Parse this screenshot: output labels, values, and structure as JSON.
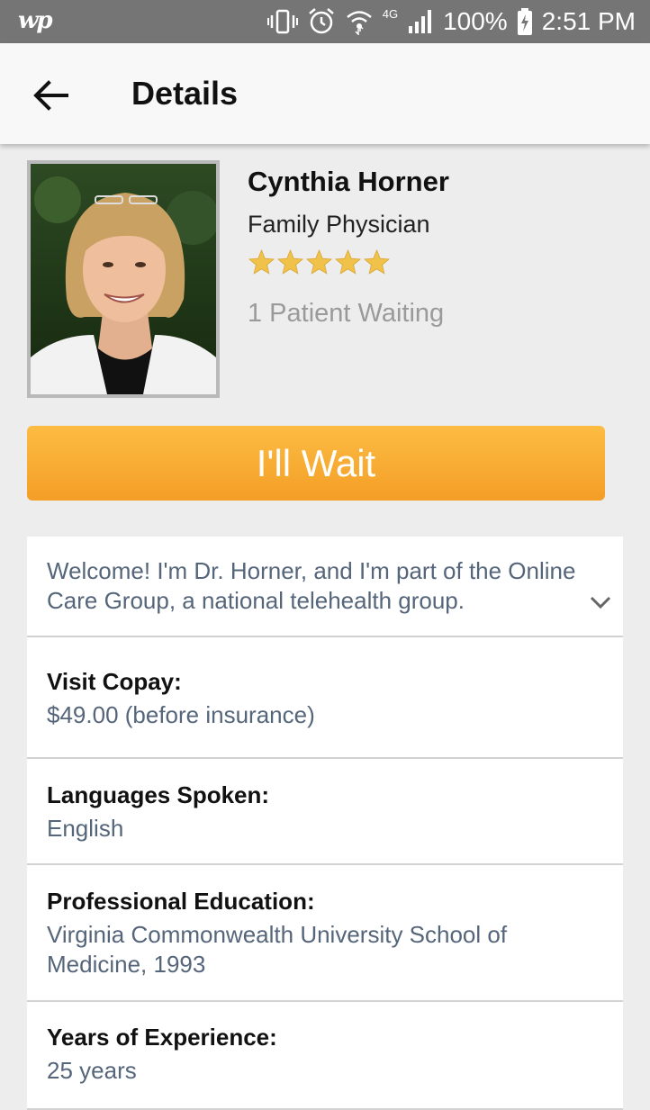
{
  "status_bar": {
    "app_badge": "wp",
    "battery": "100%",
    "time": "2:51 PM",
    "network": "4G"
  },
  "appbar": {
    "title": "Details",
    "back_icon": "arrow-back-icon"
  },
  "doctor": {
    "name": "Cynthia Horner",
    "specialty": "Family Physician",
    "rating": 5,
    "rating_max": 5,
    "waiting": "1 Patient Waiting"
  },
  "wait_button": {
    "label": "I'll Wait",
    "colors": [
      "#fcbc43",
      "#f49e26"
    ]
  },
  "intro": {
    "text": "Welcome! I'm Dr. Horner, and I'm part of the Online Care Group, a national telehealth group.",
    "expand_icon": "chevron-down-icon"
  },
  "details": {
    "copay_label": "Visit Copay:",
    "copay_value": "$49.00 (before insurance)",
    "languages_label": "Languages Spoken:",
    "languages_value": "English",
    "education_label": "Professional Education:",
    "education_value": "Virginia Commonwealth University School of Medicine, 1993",
    "experience_label": "Years of Experience:",
    "experience_value": "25 years"
  },
  "colors": {
    "star": "#f0c24a",
    "value_text": "#55657a",
    "accent": "#f49e26"
  }
}
